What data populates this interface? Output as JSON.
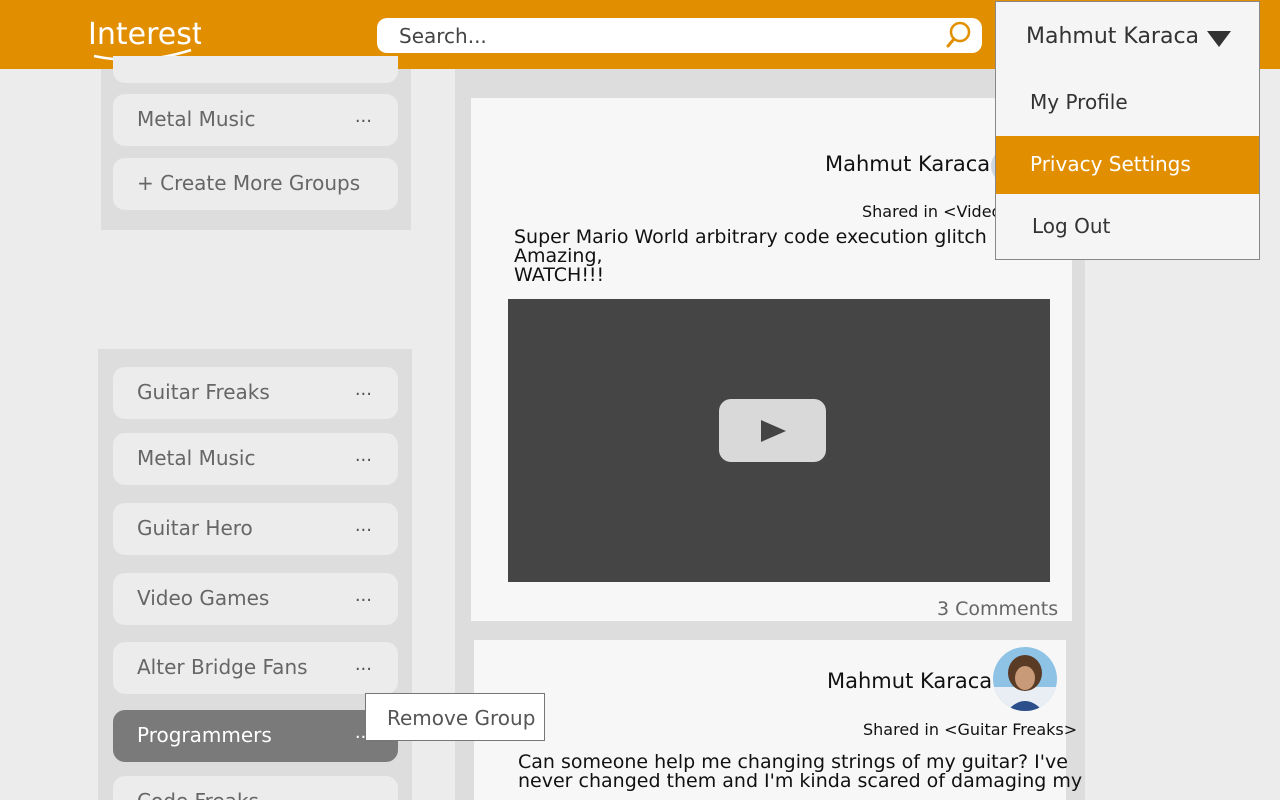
{
  "app": {
    "logo_text": "Interestr"
  },
  "search": {
    "placeholder": "Search..."
  },
  "user_menu": {
    "name": "Mahmut Karaca",
    "items": [
      {
        "label": "My Profile",
        "active": false
      },
      {
        "label": "Privacy Settings",
        "active": true
      },
      {
        "label": "Log Out",
        "active": false
      }
    ]
  },
  "sidebar": {
    "top_groups": [
      {
        "label": "Metal Music",
        "more": "..."
      }
    ],
    "create_more": "+ Create More Groups",
    "groups": [
      {
        "label": "Guitar Freaks",
        "more": "..."
      },
      {
        "label": "Metal Music",
        "more": "..."
      },
      {
        "label": "Guitar Hero",
        "more": "..."
      },
      {
        "label": "Video Games",
        "more": "..."
      },
      {
        "label": "Alter Bridge Fans",
        "more": "..."
      },
      {
        "label": "Programmers",
        "more": "...",
        "selected": true
      },
      {
        "label": "Code Freaks",
        "more": "..."
      }
    ],
    "context_menu": {
      "remove_label": "Remove Group"
    }
  },
  "feed": {
    "posts": [
      {
        "author": "Mahmut Karaca",
        "shared_in": "Shared in <Video G",
        "text_lines": [
          "Super Mario World arbitrary code execution glitch",
          "Amazing,",
          "WATCH!!!"
        ],
        "comments": "3 Comments"
      },
      {
        "author": "Mahmut Karaca",
        "shared_in": "Shared in <Guitar Freaks>",
        "text_lines": [
          "Can someone help me changing strings of my guitar? I've",
          "never changed them and I'm kinda scared of damaging my"
        ]
      }
    ]
  },
  "colors": {
    "accent": "#e18f00",
    "panel": "#dddddd",
    "video": "#454545"
  }
}
